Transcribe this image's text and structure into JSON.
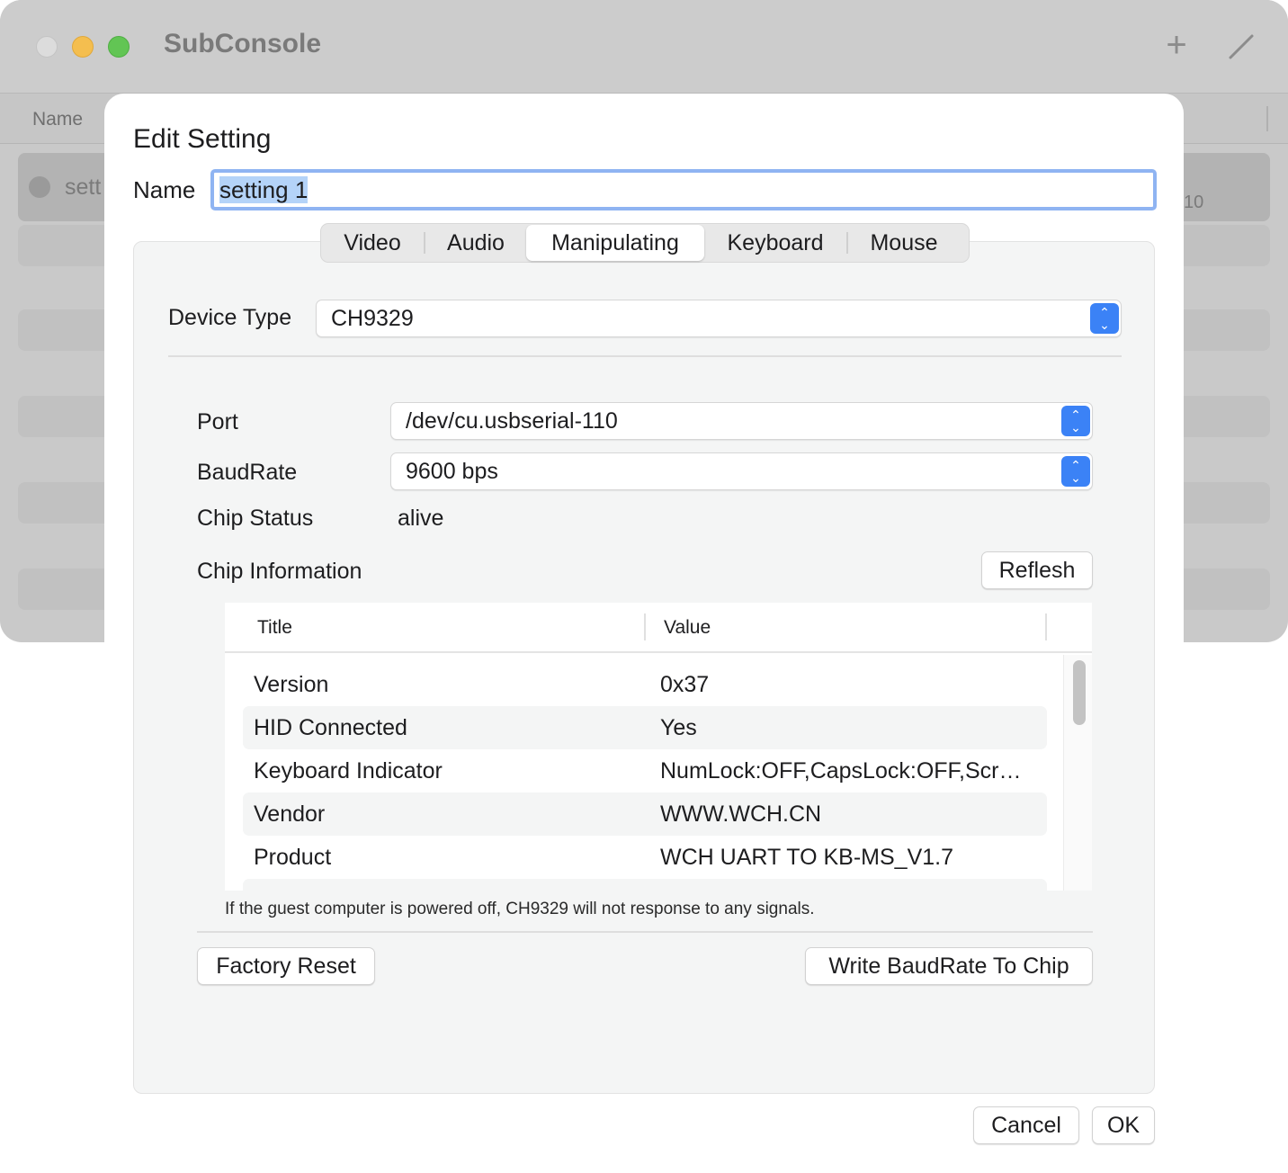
{
  "window": {
    "title": "SubConsole",
    "toolbar": {
      "add_icon": "plus-icon",
      "edit_icon": "pencil-icon"
    },
    "list": {
      "column_name": "Name",
      "selected_row_name": "sett",
      "selected_row_right": "10"
    }
  },
  "sheet": {
    "title": "Edit Setting",
    "name_label": "Name",
    "name_value": "setting 1",
    "tabs": [
      {
        "label": "Video",
        "active": false
      },
      {
        "label": "Audio",
        "active": false
      },
      {
        "label": "Manipulating",
        "active": true
      },
      {
        "label": "Keyboard",
        "active": false
      },
      {
        "label": "Mouse",
        "active": false
      }
    ],
    "device_type_label": "Device Type",
    "device_type_value": "CH9329",
    "port_label": "Port",
    "port_value": "/dev/cu.usbserial-110",
    "baudrate_label": "BaudRate",
    "baudrate_value": "9600 bps",
    "chip_status_label": "Chip Status",
    "chip_status_value": "alive",
    "chip_info_label": "Chip Information",
    "refresh_button": "Reflesh",
    "table": {
      "col_title": "Title",
      "col_value": "Value",
      "rows": [
        {
          "title": "Version",
          "value": "0x37"
        },
        {
          "title": "HID Connected",
          "value": "Yes"
        },
        {
          "title": "Keyboard Indicator",
          "value": "NumLock:OFF,CapsLock:OFF,Scr…"
        },
        {
          "title": "Vendor",
          "value": "WWW.WCH.CN"
        },
        {
          "title": "Product",
          "value": "WCH UART TO KB-MS_V1.7"
        }
      ]
    },
    "note": "If the guest computer is powered off, CH9329 will not response to any signals.",
    "factory_reset_button": "Factory Reset",
    "write_baudrate_button": "Write BaudRate To Chip",
    "cancel_button": "Cancel",
    "ok_button": "OK"
  }
}
